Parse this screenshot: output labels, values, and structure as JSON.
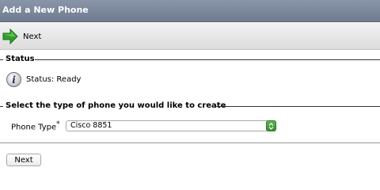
{
  "window": {
    "title": "Add a New Phone"
  },
  "toolbar": {
    "next_label": "Next",
    "next_icon": "green-arrow-right-icon"
  },
  "status": {
    "legend": "Status",
    "icon": "info-icon",
    "text": "Status: Ready"
  },
  "select_section": {
    "legend": "Select the type of phone you would like to create",
    "phone_type_label": "Phone Type",
    "required_marker": "*",
    "phone_type_value": "Cisco 8851"
  },
  "footer": {
    "next_button_label": "Next"
  },
  "colors": {
    "title_bar": "#7a869a",
    "accent_green": "#3a8f2f"
  }
}
